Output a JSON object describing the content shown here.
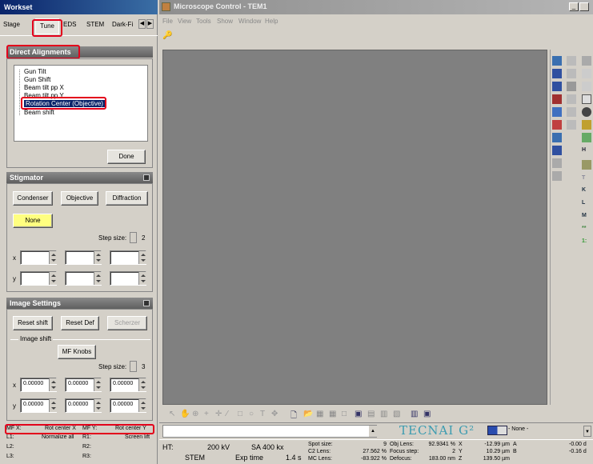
{
  "workset": {
    "title": "Workset",
    "tabs": [
      "Stage",
      "Tune",
      "EDS",
      "STEM",
      "Dark-Fi"
    ],
    "active_tab": "Tune"
  },
  "direct_alignments": {
    "title": "Direct Alignments",
    "items": [
      "Gun Tilt",
      "Gun Shift",
      "Beam tilt pp X",
      "Beam tilt pp Y",
      "Rotation Center (Objective)",
      "Beam shift"
    ],
    "selected": "Rotation Center (Objective)",
    "done_label": "Done"
  },
  "stigmator": {
    "title": "Stigmator",
    "buttons": [
      "Condenser",
      "Objective",
      "Diffraction"
    ],
    "none_label": "None",
    "step_label": "Step size:",
    "step_value": "2",
    "x_label": "x",
    "y_label": "y"
  },
  "image_settings": {
    "title": "Image Settings",
    "reset_shift": "Reset shift",
    "reset_def": "Reset Def",
    "scherzer": "Scherzer",
    "image_shift_label": "Image shift",
    "mf_knobs": "MF Knobs",
    "step_label": "Step size:",
    "step_value": "3",
    "x_label": "x",
    "y_label": "y",
    "x_values": [
      "0.00000",
      "0.00000",
      "0.00000"
    ],
    "y_values": [
      "0.00000",
      "0.00000",
      "0.00000"
    ]
  },
  "mf_table": {
    "rows": [
      [
        "MF X:",
        "Rot center X",
        "MF Y:",
        "Rot center Y"
      ],
      [
        "L1:",
        "Normalize all",
        "R1:",
        "Screen lift"
      ],
      [
        "L2:",
        "",
        "R2:",
        ""
      ],
      [
        "L3:",
        "",
        "R3:",
        ""
      ]
    ]
  },
  "microscope": {
    "title": "Microscope Control - TEM1",
    "menu": [
      "File",
      "View",
      "Tools",
      "Show",
      "Window",
      "Help"
    ],
    "brand": "TECNAI G²",
    "none_dropdown": "- None -"
  },
  "status": {
    "ht_label": "HT:",
    "ht_value": "200 kV",
    "mag": "SA 400 kx",
    "mode": "STEM",
    "exp_label": "Exp time",
    "exp_value": "1.4 s",
    "col1_labels": [
      "Spot size:",
      "C2 Lens:",
      "MC Lens:"
    ],
    "col1_values": [
      "9",
      "27.562 %",
      "-83.922 %"
    ],
    "col2_labels": [
      "Obj Lens:",
      "Focus step:",
      "Defocus:"
    ],
    "col2_values": [
      "92.9341 %",
      "2",
      "183.00 nm"
    ],
    "col3_labels": [
      "X",
      "Y",
      "Z"
    ],
    "col3_values": [
      "-12.99 µm",
      "10.29 µm",
      "139.50 µm"
    ],
    "col4_labels": [
      "A",
      "B",
      ""
    ],
    "col4_values": [
      "-0.00 d",
      "-0.16 d",
      ""
    ]
  },
  "colors": {
    "accent_red": "#e3001b",
    "selection": "#0a246a",
    "none_yellow": "#ffff80",
    "viewer_gray": "#808080"
  }
}
